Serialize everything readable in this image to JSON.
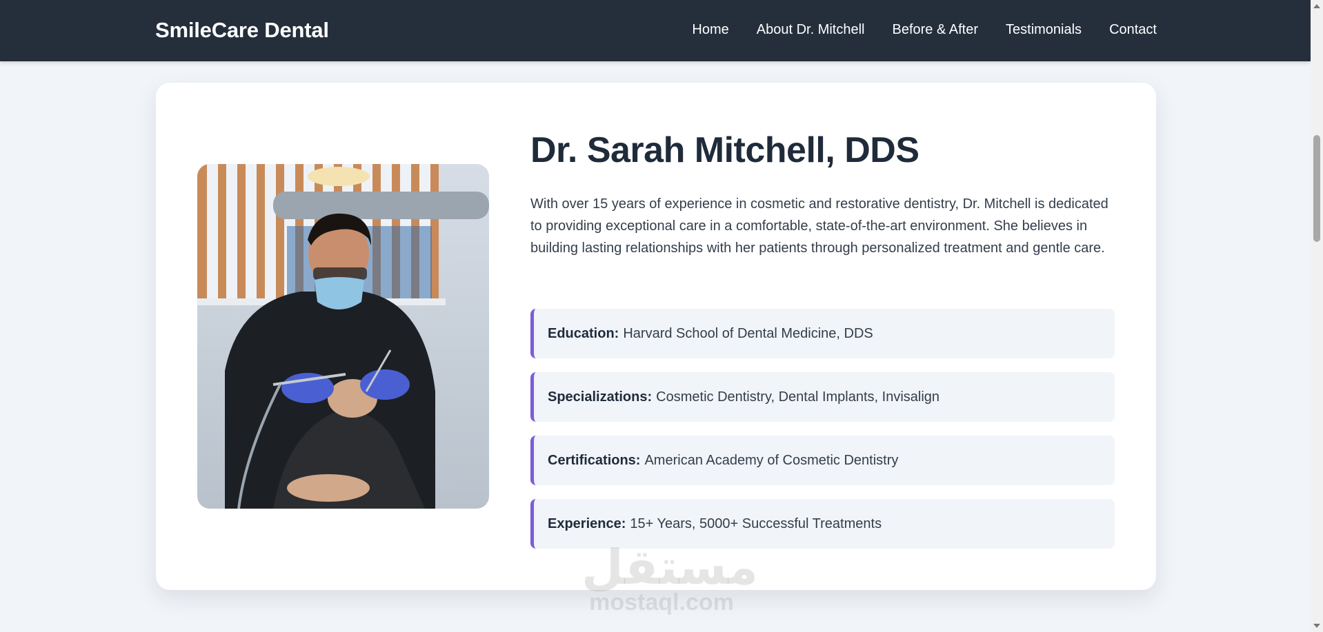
{
  "nav": {
    "brand": "SmileCare Dental",
    "links": [
      {
        "label": "Home"
      },
      {
        "label": "About Dr. Mitchell"
      },
      {
        "label": "Before & After"
      },
      {
        "label": "Testimonials"
      },
      {
        "label": "Contact"
      }
    ]
  },
  "profile": {
    "name": "Dr. Sarah Mitchell, DDS",
    "bio": "With over 15 years of experience in cosmetic and restorative dentistry, Dr. Mitchell is dedicated to providing exceptional care in a comfortable, state-of-the-art environment. She believes in building lasting relationships with her patients through personalized treatment and gentle care.",
    "credentials": [
      {
        "label": "Education:",
        "value": "Harvard School of Dental Medicine, DDS"
      },
      {
        "label": "Specializations:",
        "value": "Cosmetic Dentistry, Dental Implants, Invisalign"
      },
      {
        "label": "Certifications:",
        "value": "American Academy of Cosmetic Dentistry"
      },
      {
        "label": "Experience:",
        "value": "15+ Years, 5000+ Successful Treatments"
      }
    ]
  },
  "watermark": {
    "arabic": "مستقل",
    "latin": "mostaql.com"
  },
  "colors": {
    "nav_bg": "#252f3c",
    "page_bg": "#f1f4f8",
    "accent": "#7c5cdb",
    "heading": "#1f2b3a"
  }
}
